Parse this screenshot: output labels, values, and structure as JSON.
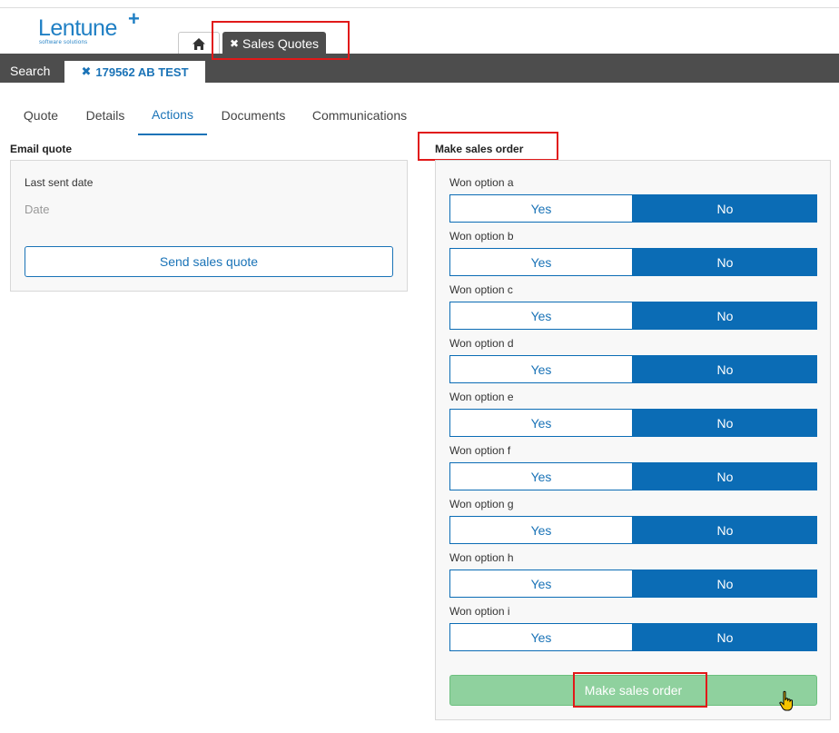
{
  "header": {
    "logo_text": "Lentune",
    "logo_plus": "+",
    "logo_sub": "software solutions",
    "home_icon": "home-icon",
    "module_tab": "Sales Quotes",
    "close_glyph": "✖"
  },
  "toolbar": {
    "search_label": "Search",
    "document_tab": "179562 AB TEST"
  },
  "tabs": [
    {
      "label": "Quote"
    },
    {
      "label": "Details"
    },
    {
      "label": "Actions"
    },
    {
      "label": "Documents"
    },
    {
      "label": "Communications"
    }
  ],
  "email_quote": {
    "title": "Email quote",
    "last_sent_label": "Last sent date",
    "date_placeholder": "Date",
    "send_button": "Send sales quote"
  },
  "make_sales_order": {
    "title": "Make sales order",
    "yes_label": "Yes",
    "no_label": "No",
    "options": [
      {
        "label": "Won option a",
        "selected": "No"
      },
      {
        "label": "Won option b",
        "selected": "No"
      },
      {
        "label": "Won option c",
        "selected": "No"
      },
      {
        "label": "Won option d",
        "selected": "No"
      },
      {
        "label": "Won option e",
        "selected": "No"
      },
      {
        "label": "Won option f",
        "selected": "No"
      },
      {
        "label": "Won option g",
        "selected": "No"
      },
      {
        "label": "Won option h",
        "selected": "No"
      },
      {
        "label": "Won option i",
        "selected": "No"
      }
    ],
    "submit_button": "Make sales order"
  },
  "colors": {
    "accent": "#0b6cb5",
    "header_bar": "#4d4d4d",
    "success": "#8fd19e",
    "highlight": "#e11919"
  }
}
